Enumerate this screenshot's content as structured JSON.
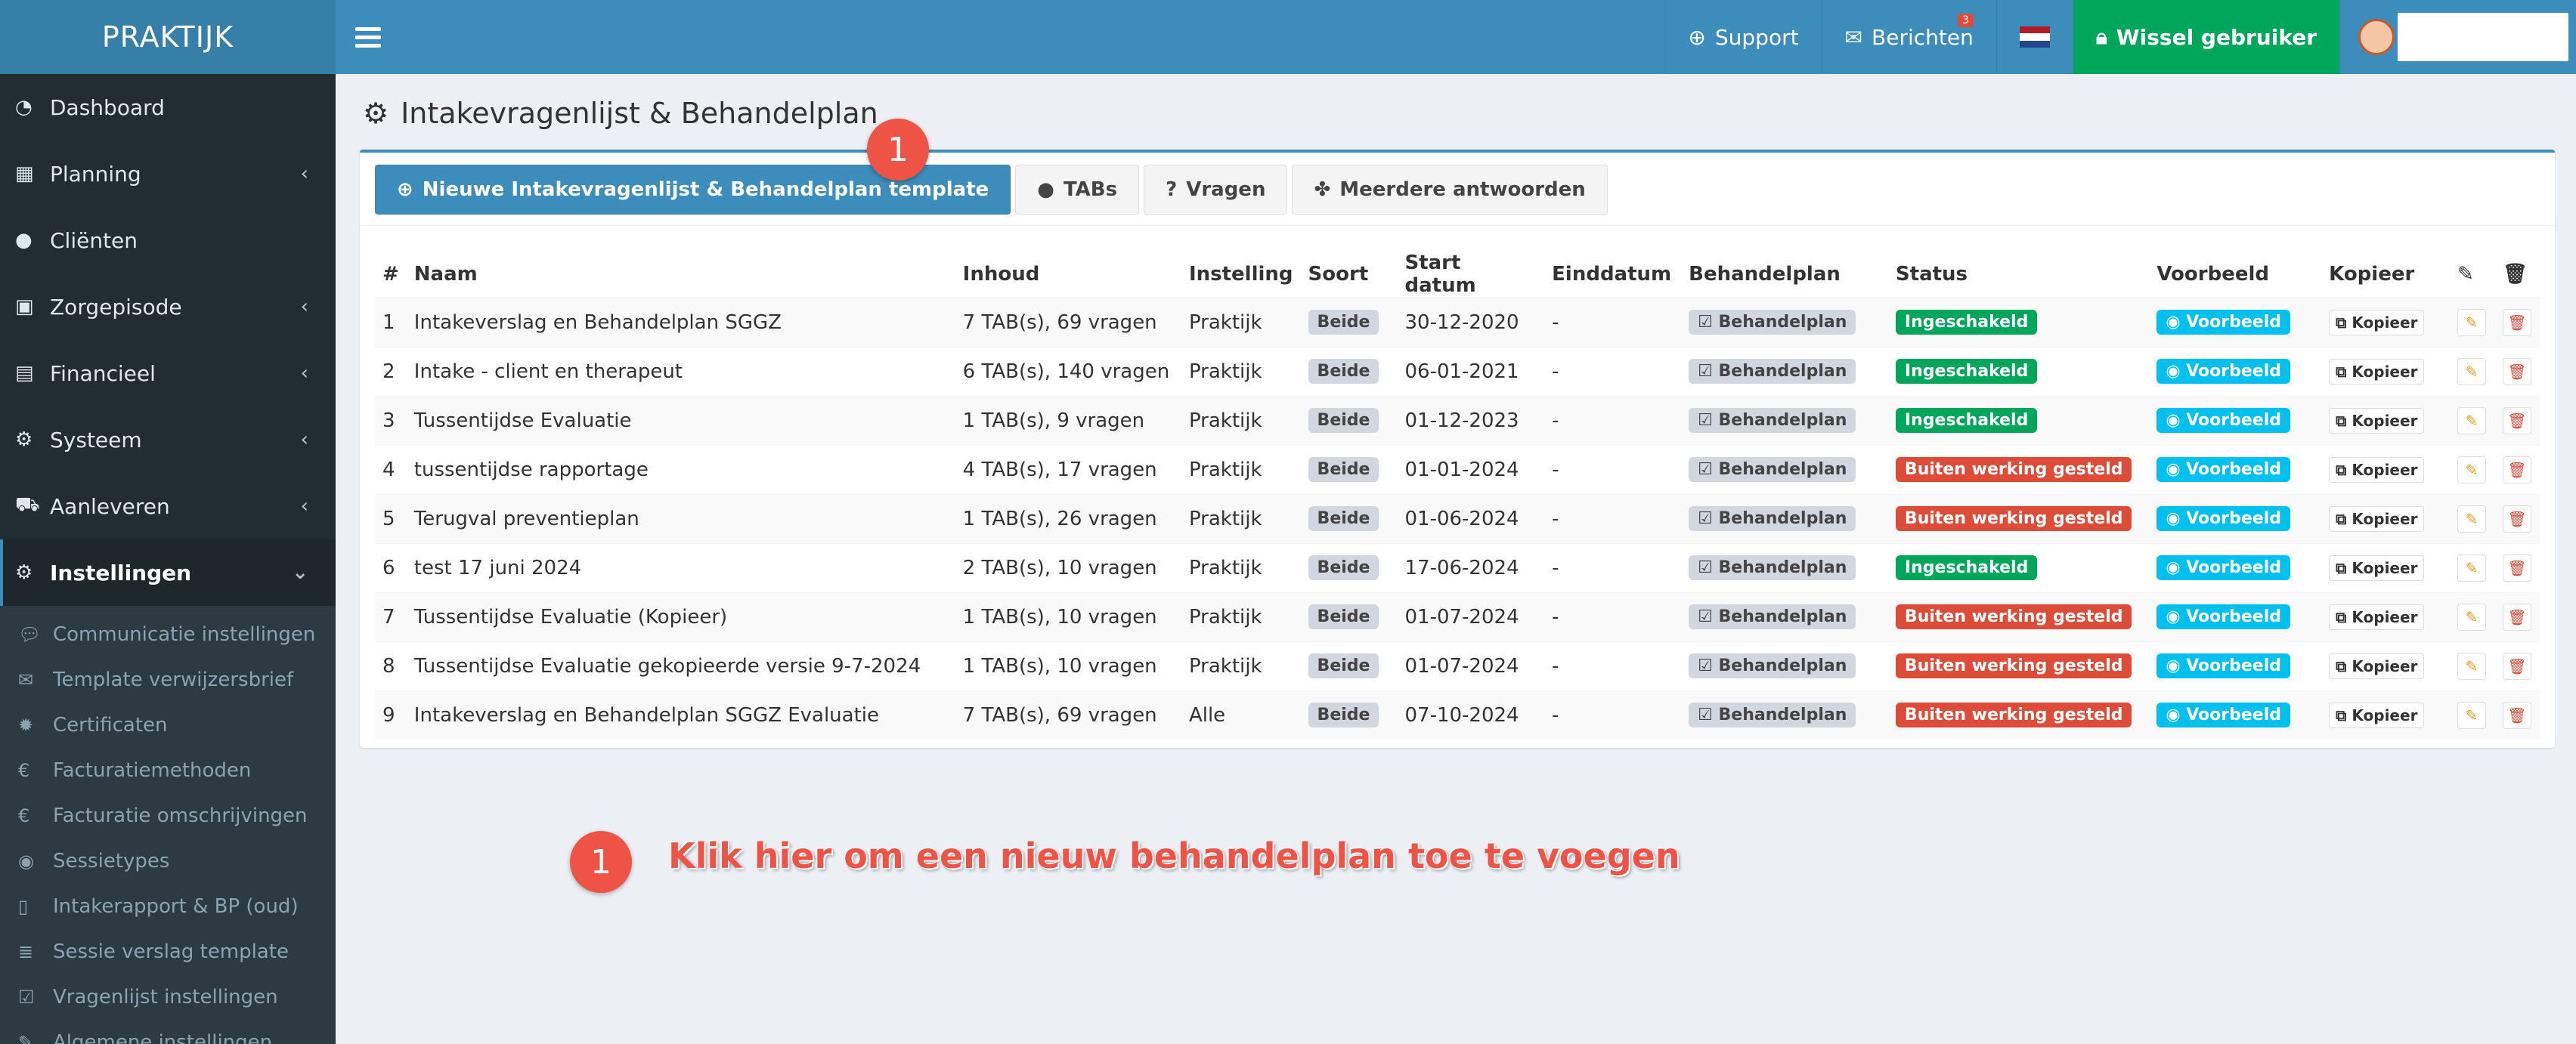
{
  "header": {
    "logo": "PRAKTIJK",
    "support": "Support",
    "messages": "Berichten",
    "messages_badge": "3",
    "switch_user": "Wissel gebruiker"
  },
  "sidebar": {
    "items": [
      {
        "label": "Dashboard",
        "icon": "dashboard-icon"
      },
      {
        "label": "Planning",
        "icon": "calendar-icon"
      },
      {
        "label": "Cliënten",
        "icon": "user-icon"
      },
      {
        "label": "Zorgepisode",
        "icon": "medkit-icon"
      },
      {
        "label": "Financieel",
        "icon": "book-icon"
      },
      {
        "label": "Systeem",
        "icon": "cogs-icon"
      },
      {
        "label": "Aanleveren",
        "icon": "truck-icon"
      },
      {
        "label": "Instellingen",
        "icon": "gear-icon"
      }
    ],
    "submenu": [
      "Communicatie instellingen",
      "Template verwijzersbrief",
      "Certificaten",
      "Facturatiemethoden",
      "Facturatie omschrijvingen",
      "Sessietypes",
      "Intakerapport & BP (oud)",
      "Sessie verslag template",
      "Vragenlijst instellingen",
      "Algemene instellingen"
    ]
  },
  "page": {
    "title": "Intakevragenlijst & Behandelplan",
    "buttons": {
      "new_template": "Nieuwe Intakevragenlijst & Behandelplan template",
      "tabs": "TABs",
      "questions": "Vragen",
      "multiple_answers": "Meerdere antwoorden"
    }
  },
  "table": {
    "headers": [
      "#",
      "Naam",
      "Inhoud",
      "Instelling",
      "Soort",
      "Start datum",
      "Einddatum",
      "Behandelplan",
      "Status",
      "Voorbeeld",
      "Kopieer"
    ],
    "rows": [
      {
        "n": "1",
        "naam": "Intakeverslag en Behandelplan SGGZ",
        "inhoud": "7 TAB(s), 69 vragen",
        "instelling": "Praktijk",
        "soort": "Beide",
        "start": "30-12-2020",
        "eind": "-",
        "plan": "Behandelplan",
        "status": "Ingeschakeld",
        "status_type": "green",
        "voorbeeld": "Voorbeeld",
        "kopieer": "Kopieer"
      },
      {
        "n": "2",
        "naam": "Intake - client en therapeut",
        "inhoud": "6 TAB(s), 140 vragen",
        "instelling": "Praktijk",
        "soort": "Beide",
        "start": "06-01-2021",
        "eind": "-",
        "plan": "Behandelplan",
        "status": "Ingeschakeld",
        "status_type": "green",
        "voorbeeld": "Voorbeeld",
        "kopieer": "Kopieer"
      },
      {
        "n": "3",
        "naam": "Tussentijdse Evaluatie",
        "inhoud": "1 TAB(s), 9 vragen",
        "instelling": "Praktijk",
        "soort": "Beide",
        "start": "01-12-2023",
        "eind": "-",
        "plan": "Behandelplan",
        "status": "Ingeschakeld",
        "status_type": "green",
        "voorbeeld": "Voorbeeld",
        "kopieer": "Kopieer"
      },
      {
        "n": "4",
        "naam": "tussentijdse rapportage",
        "inhoud": "4 TAB(s), 17 vragen",
        "instelling": "Praktijk",
        "soort": "Beide",
        "start": "01-01-2024",
        "eind": "-",
        "plan": "Behandelplan",
        "status": "Buiten werking gesteld",
        "status_type": "red",
        "voorbeeld": "Voorbeeld",
        "kopieer": "Kopieer"
      },
      {
        "n": "5",
        "naam": "Terugval preventieplan",
        "inhoud": "1 TAB(s), 26 vragen",
        "instelling": "Praktijk",
        "soort": "Beide",
        "start": "01-06-2024",
        "eind": "-",
        "plan": "Behandelplan",
        "status": "Buiten werking gesteld",
        "status_type": "red",
        "voorbeeld": "Voorbeeld",
        "kopieer": "Kopieer"
      },
      {
        "n": "6",
        "naam": "test 17 juni 2024",
        "inhoud": "2 TAB(s), 10 vragen",
        "instelling": "Praktijk",
        "soort": "Beide",
        "start": "17-06-2024",
        "eind": "-",
        "plan": "Behandelplan",
        "status": "Ingeschakeld",
        "status_type": "green",
        "voorbeeld": "Voorbeeld",
        "kopieer": "Kopieer"
      },
      {
        "n": "7",
        "naam": "Tussentijdse Evaluatie (Kopieer)",
        "inhoud": "1 TAB(s), 10 vragen",
        "instelling": "Praktijk",
        "soort": "Beide",
        "start": "01-07-2024",
        "eind": "-",
        "plan": "Behandelplan",
        "status": "Buiten werking gesteld",
        "status_type": "red",
        "voorbeeld": "Voorbeeld",
        "kopieer": "Kopieer"
      },
      {
        "n": "8",
        "naam": "Tussentijdse Evaluatie gekopieerde versie 9-7-2024",
        "inhoud": "1 TAB(s), 10 vragen",
        "instelling": "Praktijk",
        "soort": "Beide",
        "start": "01-07-2024",
        "eind": "-",
        "plan": "Behandelplan",
        "status": "Buiten werking gesteld",
        "status_type": "red",
        "voorbeeld": "Voorbeeld",
        "kopieer": "Kopieer"
      },
      {
        "n": "9",
        "naam": "Intakeverslag en Behandelplan SGGZ Evaluatie",
        "inhoud": "7 TAB(s), 69 vragen",
        "instelling": "Alle",
        "soort": "Beide",
        "start": "07-10-2024",
        "eind": "-",
        "plan": "Behandelplan",
        "status": "Buiten werking gesteld",
        "status_type": "red",
        "voorbeeld": "Voorbeeld",
        "kopieer": "Kopieer"
      }
    ]
  },
  "annotation": {
    "marker": "1",
    "text": "Klik hier om een nieuw behandelplan toe te voegen"
  },
  "colors": {
    "primary": "#3c8dbc",
    "success": "#00a65a",
    "danger": "#dd4b39",
    "info": "#00c0ef",
    "annotation": "#ef5345"
  }
}
